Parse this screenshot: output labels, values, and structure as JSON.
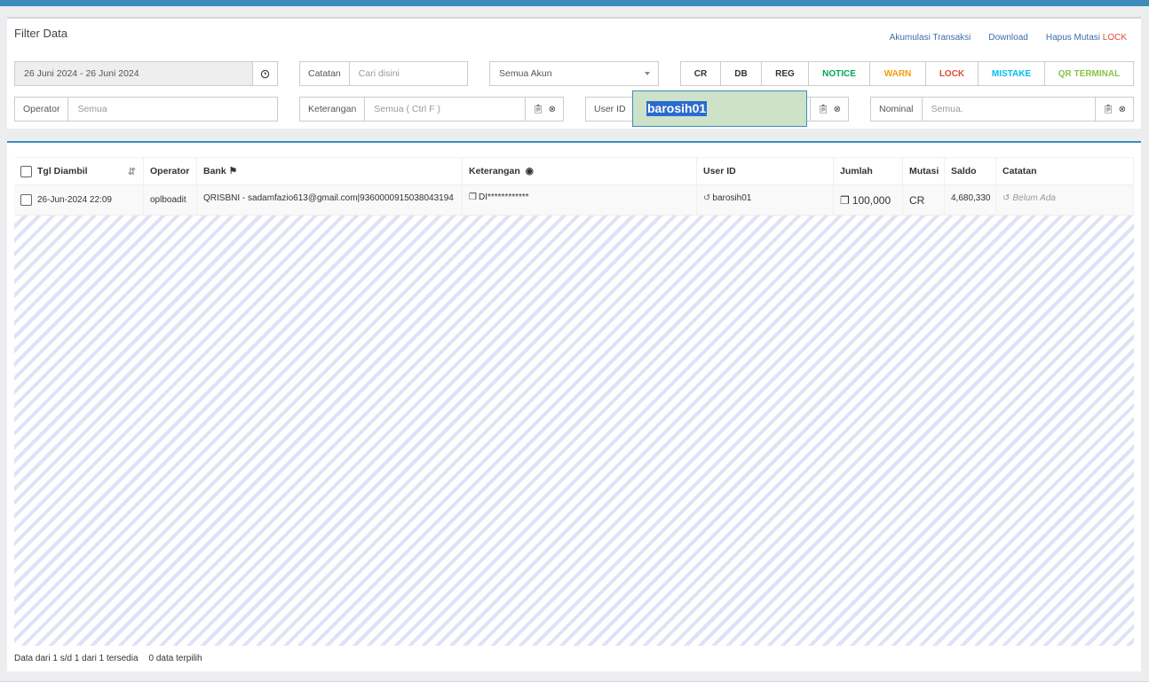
{
  "filter": {
    "title": "Filter Data",
    "links": {
      "akumulasi": "Akumulasi Transaksi",
      "download": "Download",
      "hapus": "Hapus Mutasi",
      "lock_word": "LOCK"
    },
    "date_range": "26 Juni 2024 - 26 Juni 2024",
    "catatan": {
      "label": "Catatan",
      "placeholder": "Cari disini"
    },
    "akun_select": "Semua Akun",
    "type_buttons": [
      {
        "label": "CR",
        "color": "#333333"
      },
      {
        "label": "DB",
        "color": "#333333"
      },
      {
        "label": "REG",
        "color": "#333333"
      },
      {
        "label": "NOTICE",
        "color": "#00a65a"
      },
      {
        "label": "WARN",
        "color": "#f39c12"
      },
      {
        "label": "LOCK",
        "color": "#dd4b39"
      },
      {
        "label": "MISTAKE",
        "color": "#00c0ef"
      },
      {
        "label": "QR TERMINAL",
        "color": "#8bc34a"
      }
    ],
    "operator": {
      "label": "Operator",
      "placeholder": "Semua"
    },
    "keterangan": {
      "label": "Keterangan",
      "placeholder": "Semua ( Ctrl F )"
    },
    "user_id": {
      "label": "User ID",
      "value": "barosih01"
    },
    "nominal": {
      "label": "Nominal",
      "placeholder": "Semua."
    }
  },
  "table": {
    "headers": {
      "tgl": "Tgl Diambil",
      "operator": "Operator",
      "bank": "Bank",
      "keterangan": "Keterangan",
      "user_id": "User ID",
      "jumlah": "Jumlah",
      "mutasi": "Mutasi",
      "saldo": "Saldo",
      "catatan": "Catatan"
    },
    "rows": [
      {
        "tgl": "26-Jun-2024 22:09",
        "operator": "oplboadit",
        "bank": "QRISBNI - sadamfazio613@gmail.com|9360000915038043194",
        "keterangan": "DI************",
        "user_id": "barosih01",
        "jumlah": "100,000",
        "mutasi": "CR",
        "saldo": "4,680,330",
        "catatan": "Belum Ada"
      }
    ],
    "footer": {
      "info": "Data dari 1 s/d 1 dari 1 tersedia",
      "selected": "0 data terpilih"
    }
  }
}
